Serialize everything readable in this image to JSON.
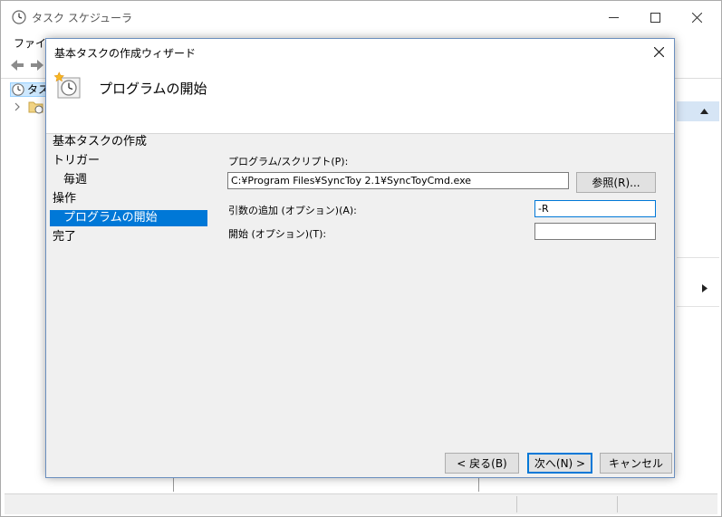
{
  "main_window": {
    "title": "タスク スケジューラ",
    "menu_visible": "ファイル",
    "tree_root_label": "タス"
  },
  "dialog": {
    "title": "基本タスクの作成ウィザード",
    "header_title": "プログラムの開始",
    "steps": [
      {
        "label": "基本タスクの作成"
      },
      {
        "label": "トリガー"
      },
      {
        "label": "毎週"
      },
      {
        "label": "操作"
      },
      {
        "label": "プログラムの開始"
      },
      {
        "label": "完了"
      }
    ],
    "program_label": "プログラム/スクリプト(P):",
    "program_value": "C:¥Program Files¥SyncToy 2.1¥SyncToyCmd.exe",
    "browse_label": "参照(R)...",
    "args_label": "引数の追加 (オプション)(A):",
    "args_value": "-R",
    "start_label": "開始 (オプション)(T):",
    "start_value": "",
    "back_label": "< 戻る(B)",
    "next_label": "次へ(N) >",
    "cancel_label": "キャンセル"
  }
}
